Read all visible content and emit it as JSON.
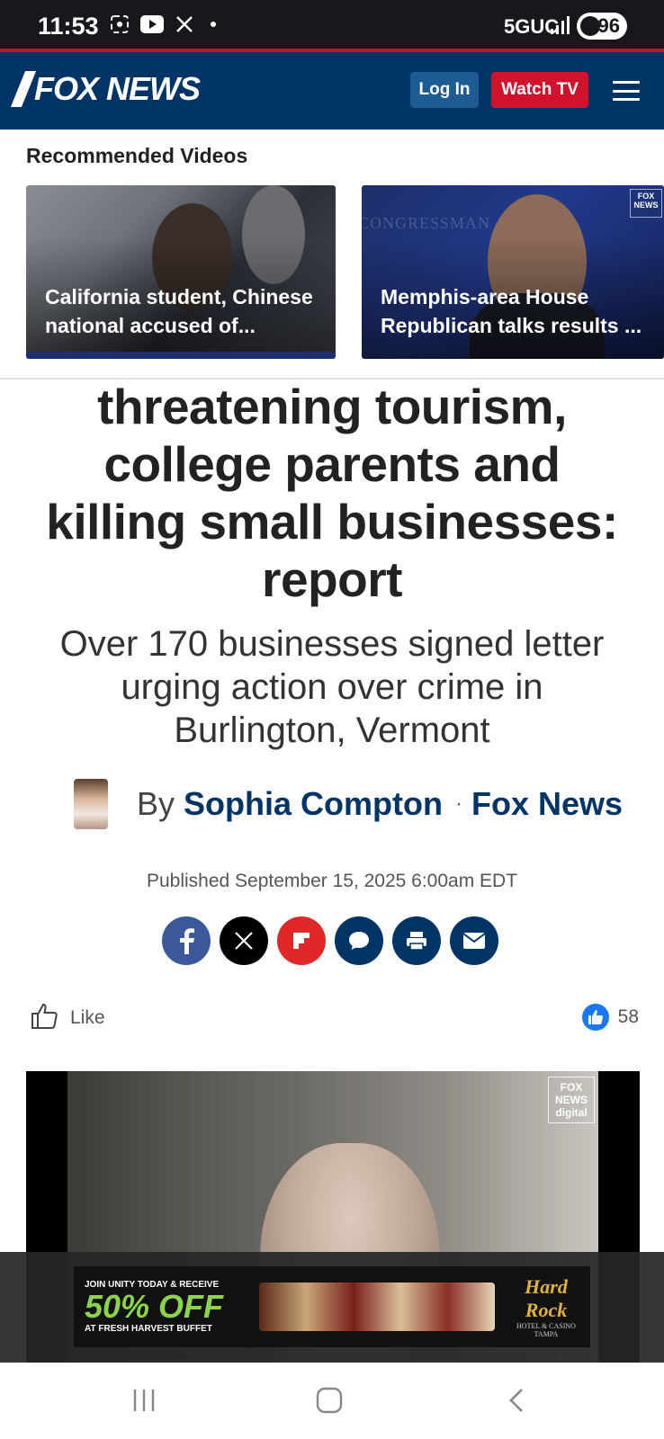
{
  "status_bar": {
    "time": "11:53",
    "network": "5GUC",
    "battery": "96",
    "icons": [
      "screenshot-icon",
      "youtube-icon",
      "x-icon",
      "notification-dot"
    ]
  },
  "header": {
    "brand": "FOX NEWS",
    "login_label": "Log In",
    "watch_label": "Watch TV",
    "colors": {
      "navy": "#003366",
      "red": "#d0122d"
    }
  },
  "recommended": {
    "title": "Recommended Videos",
    "items": [
      {
        "caption": "California student, Chinese national accused of..."
      },
      {
        "caption": "Memphis-area House Republican talks results ..."
      }
    ]
  },
  "article": {
    "headline": "threatening tourism, college parents and killing small businesses: report",
    "subhead": "Over 170 businesses signed letter urging action over crime in Burlington, Vermont",
    "by": "By",
    "author": "Sophia Compton",
    "separator": "·",
    "outlet": "Fox News",
    "published": "Published September 15, 2025 6:00am EDT"
  },
  "share": [
    "facebook-icon",
    "x-icon",
    "flipboard-icon",
    "comment-icon",
    "print-icon",
    "email-icon"
  ],
  "reactions": {
    "like_label": "Like",
    "like_count": "58"
  },
  "ad": {
    "line1": "JOIN UNITY TODAY & RECEIVE",
    "headline": "50% OFF",
    "line2": "AT FRESH HARVEST BUFFET",
    "brand": "Hard Rock",
    "brand_tag": "HOTEL & CASINO TAMPA"
  }
}
